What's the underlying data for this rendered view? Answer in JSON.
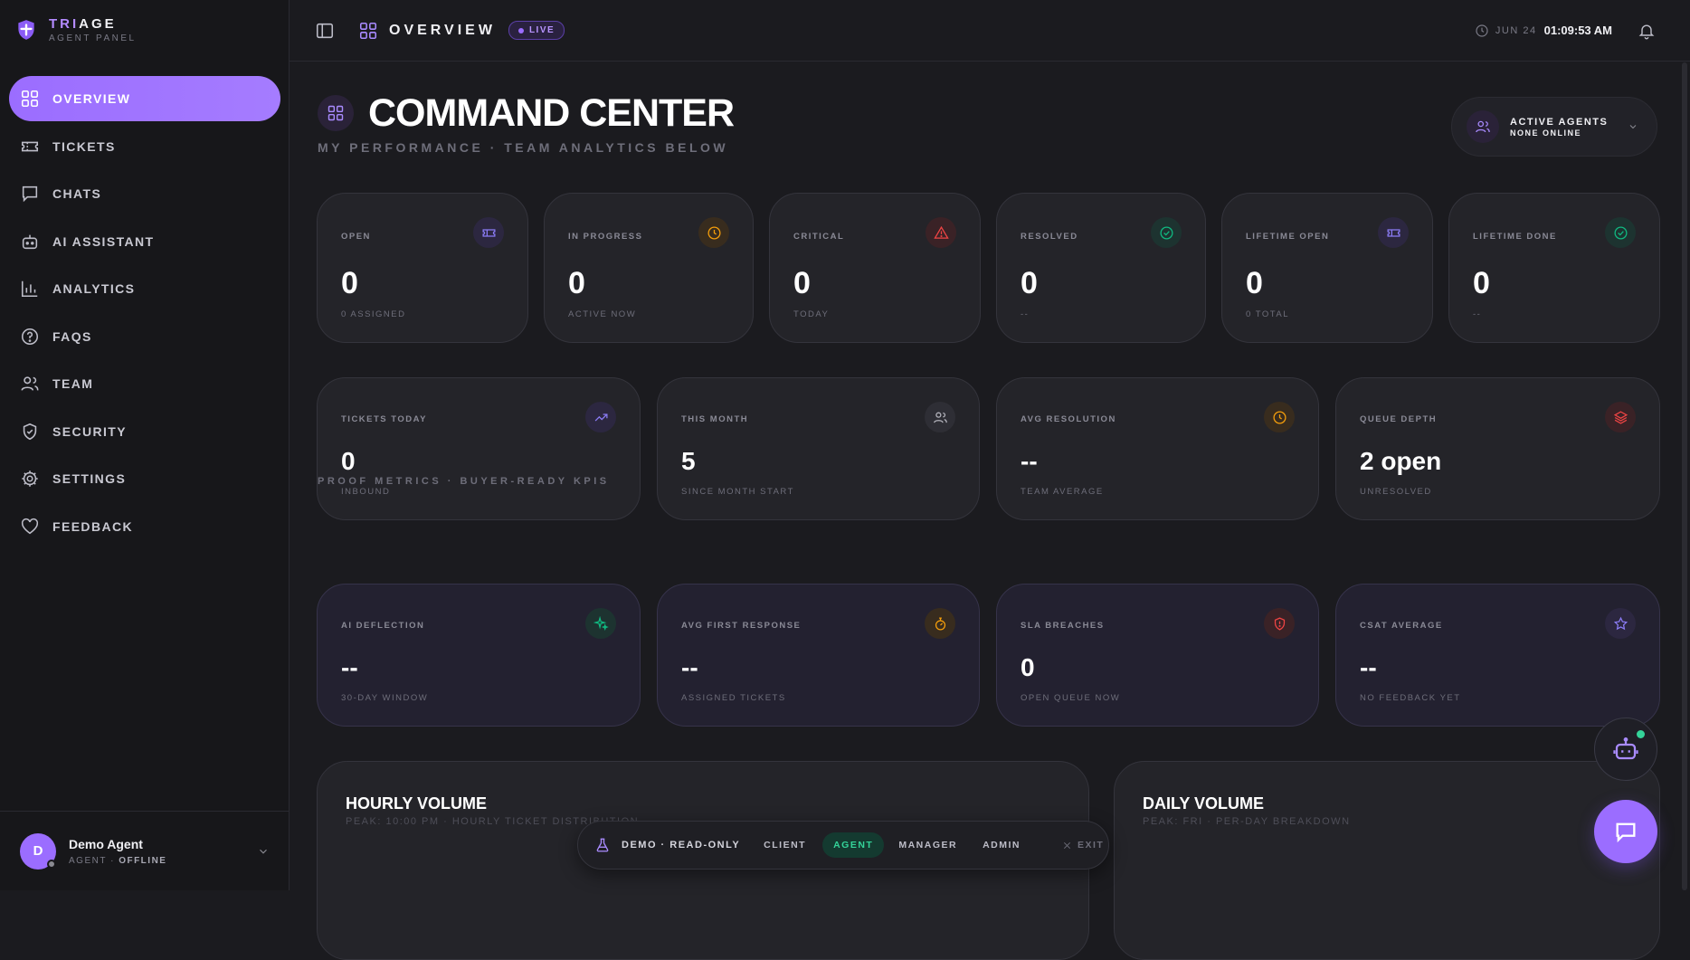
{
  "brand": {
    "name_accent": "TRI",
    "name_rest": "AGE",
    "subtitle": "AGENT PANEL"
  },
  "sidebar": {
    "items": [
      {
        "label": "OVERVIEW",
        "icon": "grid-icon",
        "active": true
      },
      {
        "label": "TICKETS",
        "icon": "ticket-icon"
      },
      {
        "label": "CHATS",
        "icon": "chat-icon"
      },
      {
        "label": "AI ASSISTANT",
        "icon": "bot-icon"
      },
      {
        "label": "ANALYTICS",
        "icon": "bar-chart-icon"
      },
      {
        "label": "FAQS",
        "icon": "help-circle-icon"
      },
      {
        "label": "TEAM",
        "icon": "users-icon"
      },
      {
        "label": "SECURITY",
        "icon": "shield-icon"
      },
      {
        "label": "SETTINGS",
        "icon": "gear-icon"
      },
      {
        "label": "FEEDBACK",
        "icon": "heart-icon"
      }
    ]
  },
  "user": {
    "initial": "D",
    "name": "Demo Agent",
    "role": "AGENT",
    "separator": "·",
    "status": "OFFLINE"
  },
  "topbar": {
    "crumb": "OVERVIEW",
    "live": "LIVE",
    "date": "JUN 24",
    "time": "01:09:53 AM"
  },
  "page": {
    "title": "COMMAND CENTER",
    "subtitle": "MY PERFORMANCE · TEAM ANALYTICS BELOW"
  },
  "agents": {
    "title": "ACTIVE AGENTS",
    "status": "NONE ONLINE"
  },
  "stats_row1": [
    {
      "label": "OPEN",
      "value": "0",
      "sub": "0 ASSIGNED",
      "icon": "ticket-icon",
      "color": "#8b7cf6"
    },
    {
      "label": "IN PROGRESS",
      "value": "0",
      "sub": "ACTIVE NOW",
      "icon": "clock-icon",
      "color": "#f59e0b"
    },
    {
      "label": "CRITICAL",
      "value": "0",
      "sub": "TODAY",
      "icon": "alert-triangle-icon",
      "color": "#ef4444"
    },
    {
      "label": "RESOLVED",
      "value": "0",
      "sub": "--",
      "icon": "check-circle-icon",
      "color": "#10b981"
    },
    {
      "label": "LIFETIME OPEN",
      "value": "0",
      "sub": "0 TOTAL",
      "icon": "ticket-icon",
      "color": "#8b7cf6"
    },
    {
      "label": "LIFETIME DONE",
      "value": "0",
      "sub": "--",
      "icon": "check-circle-icon",
      "color": "#10b981"
    }
  ],
  "stats_row2": [
    {
      "label": "TICKETS TODAY",
      "value": "0",
      "sub": "INBOUND",
      "icon": "trending-up-icon",
      "color": "#8b7cf6"
    },
    {
      "label": "THIS MONTH",
      "value": "5",
      "sub": "SINCE MONTH START",
      "icon": "users-icon",
      "color": "#9ca3af"
    },
    {
      "label": "AVG RESOLUTION",
      "value": "--",
      "sub": "TEAM AVERAGE",
      "icon": "clock-icon",
      "color": "#f59e0b"
    },
    {
      "label": "QUEUE DEPTH",
      "value": "2 open",
      "sub": "UNRESOLVED",
      "icon": "layers-icon",
      "color": "#ef4444"
    }
  ],
  "proof_label": "PROOF METRICS · BUYER-READY KPIS",
  "proof_metrics": [
    {
      "label": "AI DEFLECTION",
      "value": "--",
      "sub": "30-DAY WINDOW",
      "icon": "sparkles-icon",
      "color": "#10b981"
    },
    {
      "label": "AVG FIRST RESPONSE",
      "value": "--",
      "sub": "ASSIGNED TICKETS",
      "icon": "stopwatch-icon",
      "color": "#f59e0b"
    },
    {
      "label": "SLA BREACHES",
      "value": "0",
      "sub": "OPEN QUEUE NOW",
      "icon": "shield-alert-icon",
      "color": "#ef4444"
    },
    {
      "label": "CSAT AVERAGE",
      "value": "--",
      "sub": "NO FEEDBACK YET",
      "icon": "star-icon",
      "color": "#8b7cf6"
    }
  ],
  "panels": {
    "hourly": {
      "title": "HOURLY VOLUME",
      "sub": "PEAK: 10:00 PM · HOURLY TICKET DISTRIBUTION"
    },
    "daily": {
      "title": "DAILY VOLUME",
      "sub": "PEAK: FRI · PER-DAY BREAKDOWN"
    }
  },
  "demobar": {
    "label": "DEMO · READ-ONLY",
    "roles": [
      "CLIENT",
      "AGENT",
      "MANAGER",
      "ADMIN"
    ],
    "active_role": "AGENT",
    "exit": "EXIT"
  }
}
